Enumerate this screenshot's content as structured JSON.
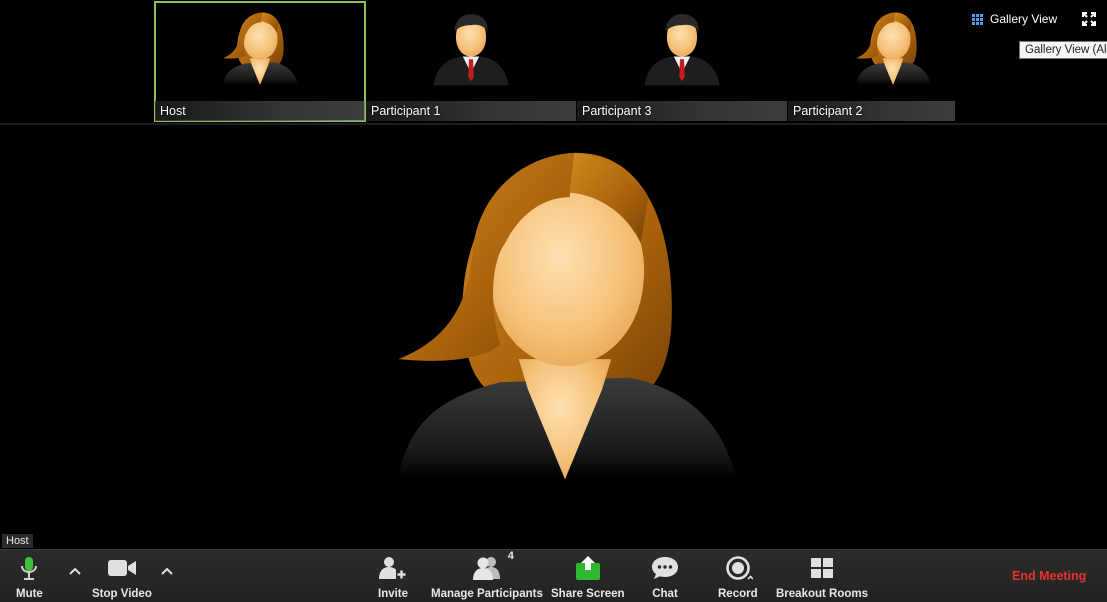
{
  "thumbnails": [
    {
      "name": "Host",
      "avatar": "female-avatar-icon",
      "active": true
    },
    {
      "name": "Participant 1",
      "avatar": "male-avatar-icon",
      "active": false
    },
    {
      "name": "Participant 3",
      "avatar": "male-avatar-icon",
      "active": false
    },
    {
      "name": "Participant 2",
      "avatar": "female-avatar-icon",
      "active": false
    }
  ],
  "view_controls": {
    "gallery_label": "Gallery View",
    "gallery_icon": "grid-icon",
    "fullscreen_icon": "fullscreen-icon",
    "tooltip": "Gallery View (Al"
  },
  "main_video": {
    "speaker_name": "Host",
    "avatar": "female-avatar-icon"
  },
  "toolbar": {
    "mute_label": "Mute",
    "stop_video_label": "Stop Video",
    "invite_label": "Invite",
    "manage_participants_label": "Manage Participants",
    "participant_count": "4",
    "share_screen_label": "Share Screen",
    "chat_label": "Chat",
    "record_label": "Record",
    "breakout_rooms_label": "Breakout Rooms",
    "end_meeting_label": "End Meeting"
  },
  "colors": {
    "active_border": "#8fc05a",
    "mic_green": "#3ec23e",
    "share_green": "#2db92d",
    "end_meeting_red": "#e8322b",
    "hair_brown": "#b06a0d",
    "skin": "#f6c27a"
  }
}
